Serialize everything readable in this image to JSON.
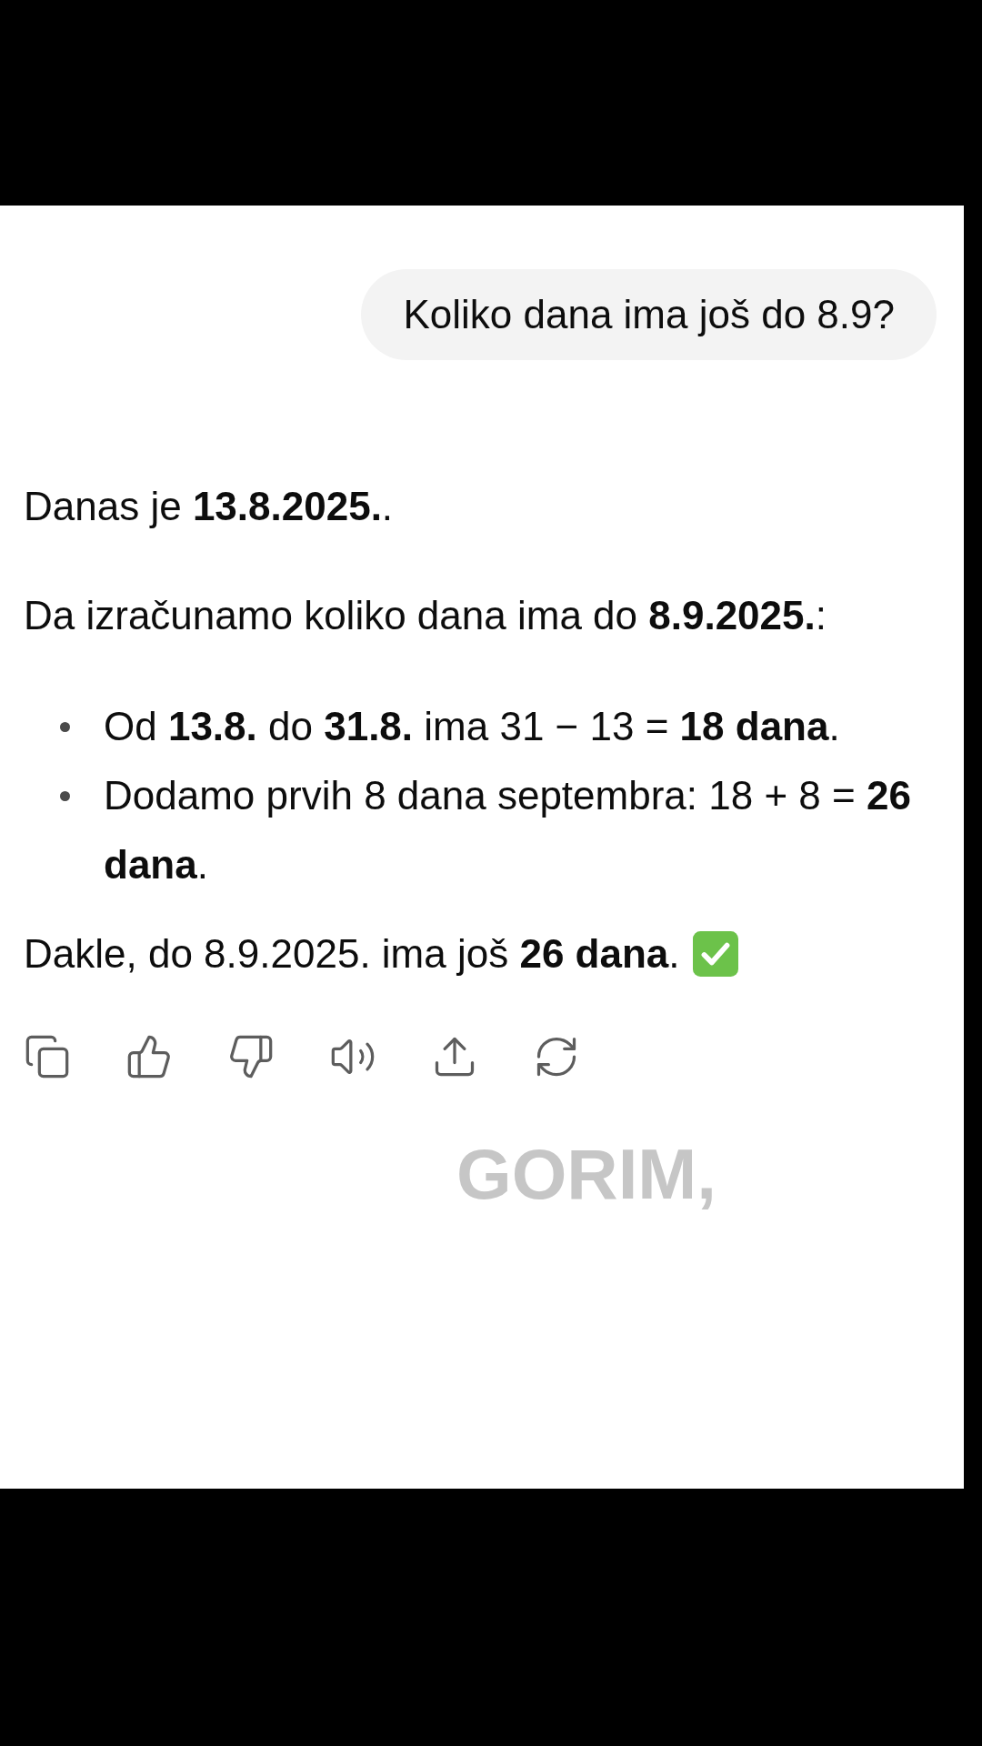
{
  "user_message": {
    "text": "Koliko dana ima još do 8.9?"
  },
  "answer": {
    "blocks": [
      {
        "kind": "paragraph",
        "text": "Danas je **13.8.2025.**."
      },
      {
        "kind": "paragraph",
        "text": "Da izračunamo koliko dana ima do **8.9.2025.**:"
      },
      {
        "kind": "bullets",
        "items": [
          "Od **13.8.** do **31.8.** ima 31 − 13 = **18 dana**.",
          "Dodamo prvih 8 dana septembra: 18 + 8 = **26 dana**."
        ]
      },
      {
        "kind": "paragraph",
        "text": "Dakle, do 8.9.2025. ima još **26 dana**."
      }
    ]
  },
  "caption": "GORIM,"
}
